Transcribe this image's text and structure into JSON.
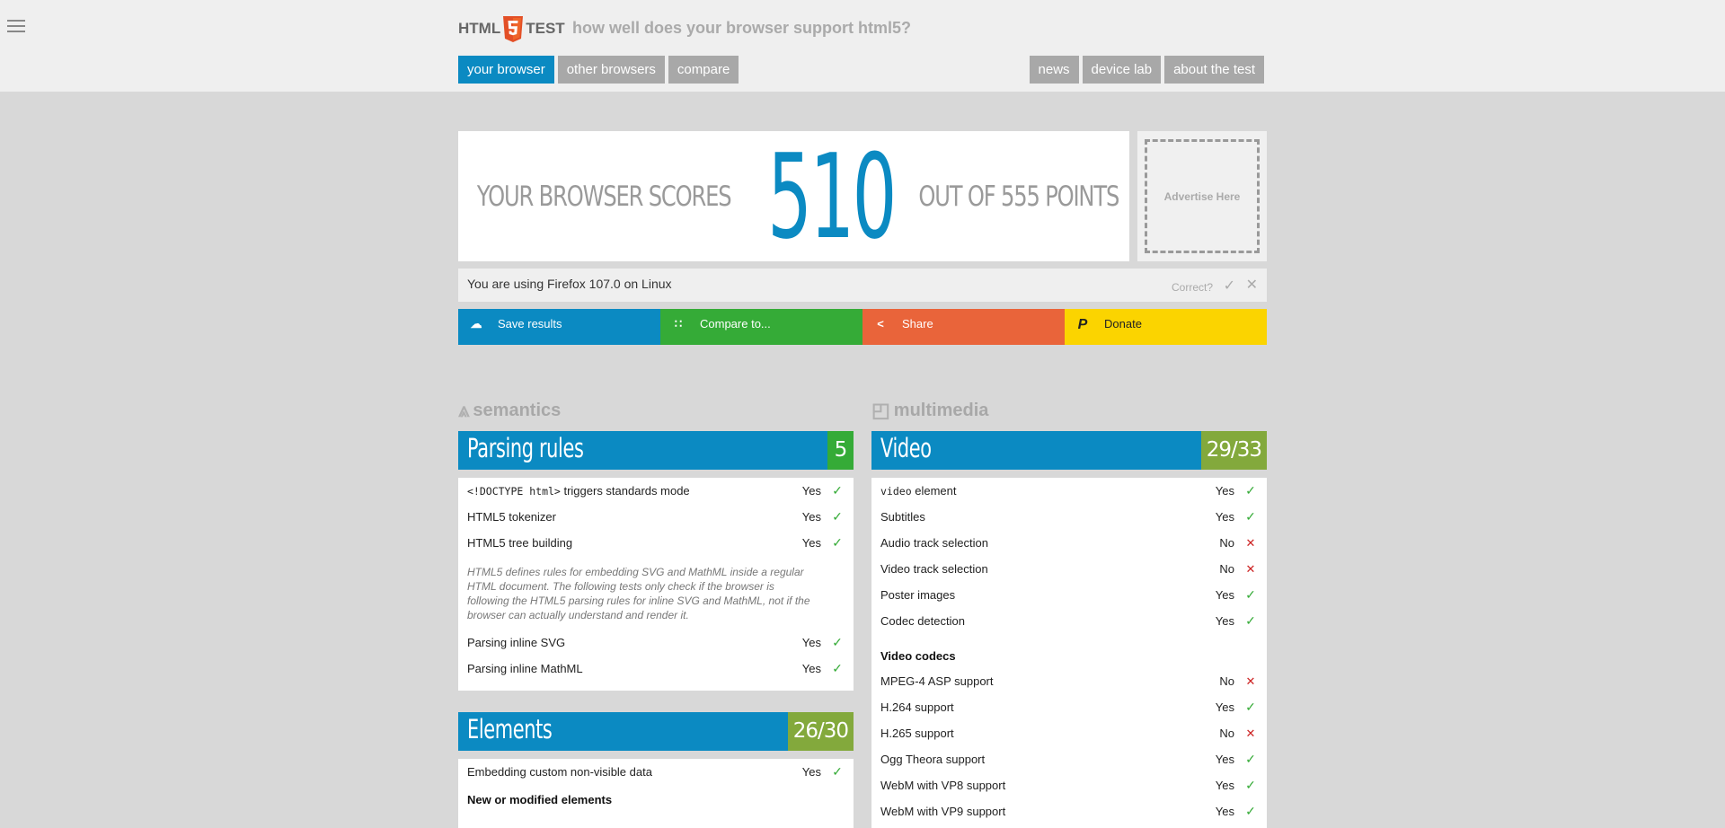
{
  "header": {
    "logo_left": "HTML",
    "logo_right": "TEST",
    "tagline": "how well does your browser support html5?"
  },
  "nav": {
    "left": [
      "your browser",
      "other browsers",
      "compare"
    ],
    "right": [
      "news",
      "device lab",
      "about the test"
    ]
  },
  "score": {
    "pre": "YOUR BROWSER SCORES",
    "value": "510",
    "post": "OUT OF 555 POINTS"
  },
  "ad": {
    "label": "Advertise Here"
  },
  "useragent": {
    "text": "You are using Firefox 107.0 on Linux",
    "correct": "Correct?"
  },
  "actions": {
    "save": "Save results",
    "compare": "Compare to...",
    "share": "Share",
    "donate": "Donate"
  },
  "categories": {
    "left": "semantics",
    "right": "multimedia"
  },
  "parsing": {
    "title": "Parsing rules",
    "score": "5",
    "rows": [
      {
        "code": "<!DOCTYPE html>",
        "label": " triggers standards mode",
        "result": "Yes"
      },
      {
        "label": "HTML5 tokenizer",
        "result": "Yes"
      },
      {
        "label": "HTML5 tree building",
        "result": "Yes"
      }
    ],
    "note": "HTML5 defines rules for embedding SVG and MathML inside a regular HTML document. The following tests only check if the browser is following the HTML5 parsing rules for inline SVG and MathML, not if the browser can actually understand and render it.",
    "rows2": [
      {
        "label": "Parsing inline SVG",
        "result": "Yes"
      },
      {
        "label": "Parsing inline MathML",
        "result": "Yes"
      }
    ]
  },
  "elements": {
    "title": "Elements",
    "score": "26/30",
    "rows": [
      {
        "label": "Embedding custom non-visible data",
        "result": "Yes"
      }
    ],
    "subhead": "New or modified elements"
  },
  "video": {
    "title": "Video",
    "score": "29/33",
    "rows": [
      {
        "code": "video",
        "label": " element",
        "result": "Yes"
      },
      {
        "label": "Subtitles",
        "result": "Yes"
      },
      {
        "label": "Audio track selection",
        "result": "No"
      },
      {
        "label": "Video track selection",
        "result": "No"
      },
      {
        "label": "Poster images",
        "result": "Yes"
      },
      {
        "label": "Codec detection",
        "result": "Yes"
      }
    ],
    "subhead": "Video codecs",
    "codecs": [
      {
        "label": "MPEG-4 ASP support",
        "result": "No"
      },
      {
        "label": "H.264 support",
        "result": "Yes"
      },
      {
        "label": "H.265 support",
        "result": "No"
      },
      {
        "label": "Ogg Theora support",
        "result": "Yes"
      },
      {
        "label": "WebM with VP8 support",
        "result": "Yes"
      },
      {
        "label": "WebM with VP9 support",
        "result": "Yes"
      }
    ]
  }
}
